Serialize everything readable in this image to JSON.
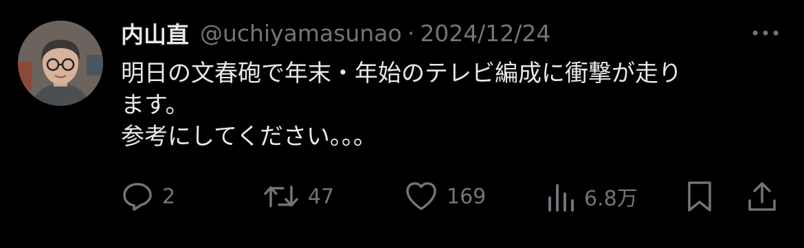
{
  "tweet": {
    "author": {
      "name": "内山直",
      "handle": "@uchiyamasunao",
      "separator": "·",
      "date": "2024/12/24"
    },
    "text_lines": [
      "明日の文春砲で年末・年始のテレビ編成に衝撃が走り",
      "ます。",
      "参考にしてください。。。"
    ],
    "actions": {
      "reply": {
        "icon": "reply-icon",
        "count": "2"
      },
      "retweet": {
        "icon": "retweet-icon",
        "count": "47"
      },
      "like": {
        "icon": "heart-icon",
        "count": "169"
      },
      "views": {
        "icon": "views-icon",
        "count": "6.8万"
      },
      "bookmark": {
        "icon": "bookmark-icon"
      },
      "share": {
        "icon": "share-icon"
      }
    },
    "colors": {
      "background": "#000000",
      "text": "#e7e9ea",
      "secondary": "#71767b"
    }
  }
}
